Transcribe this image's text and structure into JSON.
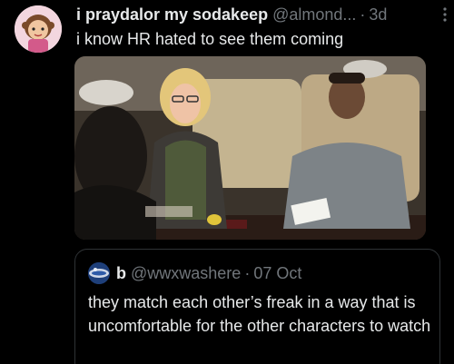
{
  "tweet": {
    "display_name": "i praydalor my sodakeep",
    "handle": "@almond...",
    "separator": "·",
    "time": "3d",
    "text": "i know HR hated to see them coming",
    "avatar_icon": "cartoon-girl-avatar-icon",
    "more_icon": "more-options-icon"
  },
  "quote": {
    "display_name": "b",
    "handle": "@wwxwashere",
    "separator": "·",
    "time": "07 Oct",
    "text": "they match each other’s freak in a way that is uncomfortable for the other characters to watch",
    "avatar_icon": "blue-globe-avatar-icon"
  },
  "colors": {
    "background": "#000000",
    "text_primary": "#e7e9ea",
    "text_secondary": "#71767b",
    "border": "#2f3336"
  }
}
